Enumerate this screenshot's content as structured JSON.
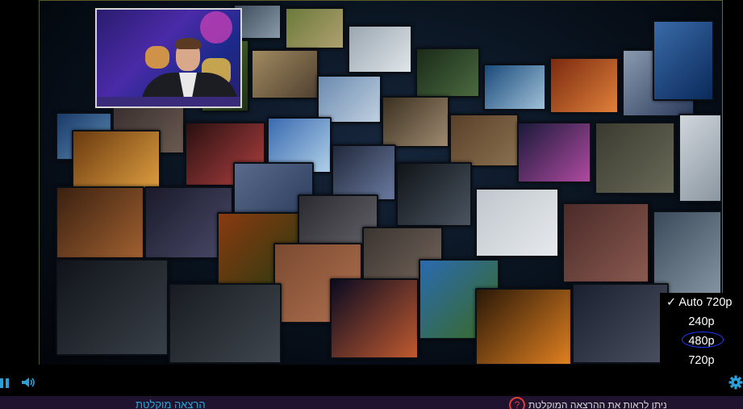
{
  "player": {
    "video_description_icon": "video-wall-montage",
    "pip_icon": "presenter-inset",
    "quality_menu": {
      "items": [
        {
          "label": "✓ Auto 720p",
          "selected": true
        },
        {
          "label": "240p",
          "selected": false
        },
        {
          "label": "480p",
          "selected": false,
          "annotated": true
        },
        {
          "label": "720p",
          "selected": false
        }
      ]
    },
    "controls": {
      "play_pause_icon": "pause-icon",
      "volume_icon": "volume-icon",
      "settings_icon": "gear-icon",
      "accent_color": "#2a9fd8"
    }
  },
  "footer": {
    "link_label": "הרצאה מוקלטת",
    "message": "ניתן לראות את ההרצאה המוקלטת",
    "help_symbol": "?",
    "background": "#1f1330"
  }
}
